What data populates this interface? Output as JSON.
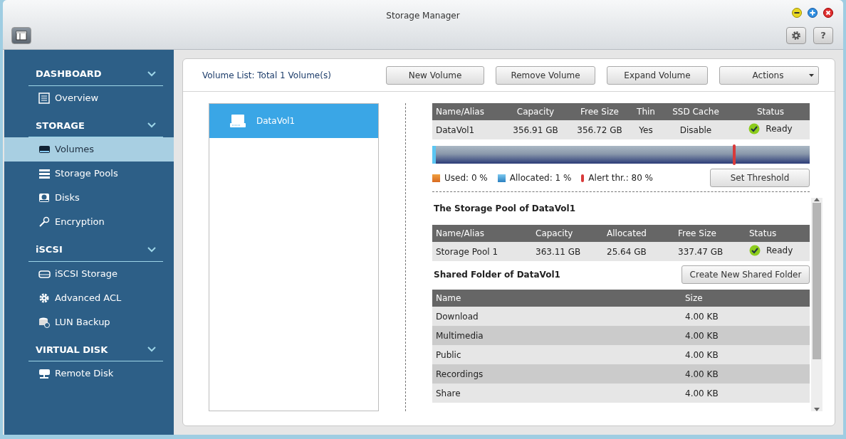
{
  "window": {
    "title": "Storage Manager",
    "help_button": "?"
  },
  "sidebar": {
    "sections": [
      {
        "label": "DASHBOARD",
        "expanded": true,
        "items": [
          {
            "label": "Overview",
            "selected": false
          }
        ]
      },
      {
        "label": "STORAGE",
        "expanded": true,
        "items": [
          {
            "label": "Volumes",
            "selected": true
          },
          {
            "label": "Storage Pools",
            "selected": false
          },
          {
            "label": "Disks",
            "selected": false
          },
          {
            "label": "Encryption",
            "selected": false
          }
        ]
      },
      {
        "label": "iSCSI",
        "expanded": true,
        "items": [
          {
            "label": "iSCSI Storage",
            "selected": false
          },
          {
            "label": "Advanced ACL",
            "selected": false
          },
          {
            "label": "LUN Backup",
            "selected": false
          }
        ]
      },
      {
        "label": "VIRTUAL DISK",
        "expanded": true,
        "items": [
          {
            "label": "Remote Disk",
            "selected": false
          }
        ]
      }
    ]
  },
  "volume_list": {
    "title": "Volume List: Total 1 Volume(s)",
    "buttons": [
      {
        "label": "New Volume",
        "kind": "plain"
      },
      {
        "label": "Remove Volume",
        "kind": "plain"
      },
      {
        "label": "Expand Volume",
        "kind": "plain"
      },
      {
        "label": "Actions",
        "kind": "dropdown"
      }
    ],
    "volumes": [
      {
        "name": "DataVol1",
        "selected": true
      }
    ]
  },
  "volume_table": {
    "columns": [
      "Name/Alias",
      "Capacity",
      "Free Size",
      "Thin",
      "SSD Cache",
      "Status"
    ],
    "rows": [
      [
        "DataVol1",
        "356.91 GB",
        "356.72 GB",
        "Yes",
        "Disable",
        "Ready"
      ]
    ]
  },
  "usage_bar": {
    "used": {
      "label": "Used: 0 %"
    },
    "allocated": {
      "level": 0.01,
      "label": "Allocated: 1 %"
    },
    "alert": {
      "level": 0.8,
      "label": "Alert thr.: 80 %"
    },
    "button": "Set Threshold"
  },
  "pool": {
    "title": "The Storage Pool of DataVol1",
    "columns": [
      "Name/Alias",
      "Capacity",
      "Allocated",
      "Free Size",
      "Status"
    ],
    "rows": [
      [
        "Storage Pool 1",
        "363.11 GB",
        "25.64 GB",
        "337.47 GB",
        "Ready"
      ]
    ]
  },
  "shared_folders": {
    "title": "Shared Folder of DataVol1",
    "button": "Create New Shared Folder",
    "columns": [
      "Name",
      "Size"
    ],
    "rows": [
      [
        "Download",
        "4.00 KB"
      ],
      [
        "Multimedia",
        "4.00 KB"
      ],
      [
        "Public",
        "4.00 KB"
      ],
      [
        "Recordings",
        "4.00 KB"
      ],
      [
        "Share",
        "4.00 KB"
      ]
    ]
  }
}
